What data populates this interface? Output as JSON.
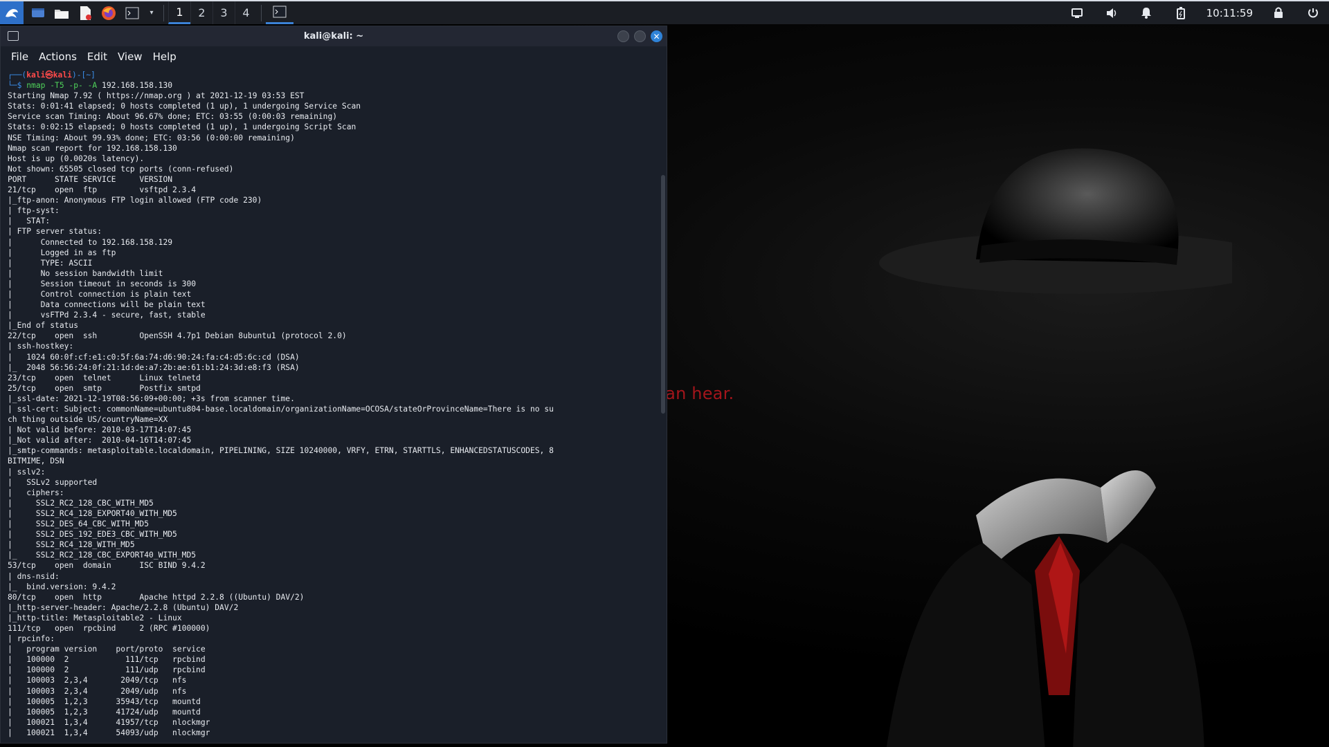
{
  "taskbar": {
    "workspaces": [
      "1",
      "2",
      "3",
      "4"
    ],
    "clock": "10:11:59",
    "accent": "#3b82d6"
  },
  "wallpaper": {
    "quote": "The quieter you become, the more you can hear."
  },
  "terminal": {
    "title": "kali@kali: ~",
    "menu": [
      "File",
      "Actions",
      "Edit",
      "View",
      "Help"
    ],
    "prompt_line1_a": "┌──(",
    "prompt_user": "kali㉿kali",
    "prompt_line1_b": ")-[~]",
    "prompt_line2": "└─$ ",
    "prompt_cmd": "nmap -T5 -p- -A",
    "prompt_target": " 192.168.158.130",
    "output": "Starting Nmap 7.92 ( https://nmap.org ) at 2021-12-19 03:53 EST\nStats: 0:01:41 elapsed; 0 hosts completed (1 up), 1 undergoing Service Scan\nService scan Timing: About 96.67% done; ETC: 03:55 (0:00:03 remaining)\nStats: 0:02:15 elapsed; 0 hosts completed (1 up), 1 undergoing Script Scan\nNSE Timing: About 99.93% done; ETC: 03:56 (0:00:00 remaining)\nNmap scan report for 192.168.158.130\nHost is up (0.0020s latency).\nNot shown: 65505 closed tcp ports (conn-refused)\nPORT      STATE SERVICE     VERSION\n21/tcp    open  ftp         vsftpd 2.3.4\n|_ftp-anon: Anonymous FTP login allowed (FTP code 230)\n| ftp-syst:\n|   STAT:\n| FTP server status:\n|      Connected to 192.168.158.129\n|      Logged in as ftp\n|      TYPE: ASCII\n|      No session bandwidth limit\n|      Session timeout in seconds is 300\n|      Control connection is plain text\n|      Data connections will be plain text\n|      vsFTPd 2.3.4 - secure, fast, stable\n|_End of status\n22/tcp    open  ssh         OpenSSH 4.7p1 Debian 8ubuntu1 (protocol 2.0)\n| ssh-hostkey:\n|   1024 60:0f:cf:e1:c0:5f:6a:74:d6:90:24:fa:c4:d5:6c:cd (DSA)\n|_  2048 56:56:24:0f:21:1d:de:a7:2b:ae:61:b1:24:3d:e8:f3 (RSA)\n23/tcp    open  telnet      Linux telnetd\n25/tcp    open  smtp        Postfix smtpd\n|_ssl-date: 2021-12-19T08:56:09+00:00; +3s from scanner time.\n| ssl-cert: Subject: commonName=ubuntu804-base.localdomain/organizationName=OCOSA/stateOrProvinceName=There is no su\nch thing outside US/countryName=XX\n| Not valid before: 2010-03-17T14:07:45\n|_Not valid after:  2010-04-16T14:07:45\n|_smtp-commands: metasploitable.localdomain, PIPELINING, SIZE 10240000, VRFY, ETRN, STARTTLS, ENHANCEDSTATUSCODES, 8\nBITMIME, DSN\n| sslv2:\n|   SSLv2 supported\n|   ciphers:\n|     SSL2_RC2_128_CBC_WITH_MD5\n|     SSL2_RC4_128_EXPORT40_WITH_MD5\n|     SSL2_DES_64_CBC_WITH_MD5\n|     SSL2_DES_192_EDE3_CBC_WITH_MD5\n|     SSL2_RC4_128_WITH_MD5\n|_    SSL2_RC2_128_CBC_EXPORT40_WITH_MD5\n53/tcp    open  domain      ISC BIND 9.4.2\n| dns-nsid:\n|_  bind.version: 9.4.2\n80/tcp    open  http        Apache httpd 2.2.8 ((Ubuntu) DAV/2)\n|_http-server-header: Apache/2.2.8 (Ubuntu) DAV/2\n|_http-title: Metasploitable2 - Linux\n111/tcp   open  rpcbind     2 (RPC #100000)\n| rpcinfo:\n|   program version    port/proto  service\n|   100000  2            111/tcp   rpcbind\n|   100000  2            111/udp   rpcbind\n|   100003  2,3,4       2049/tcp   nfs\n|   100003  2,3,4       2049/udp   nfs\n|   100005  1,2,3      35943/tcp   mountd\n|   100005  1,2,3      41724/udp   mountd\n|   100021  1,3,4      41957/tcp   nlockmgr\n|   100021  1,3,4      54093/udp   nlockmgr"
  }
}
